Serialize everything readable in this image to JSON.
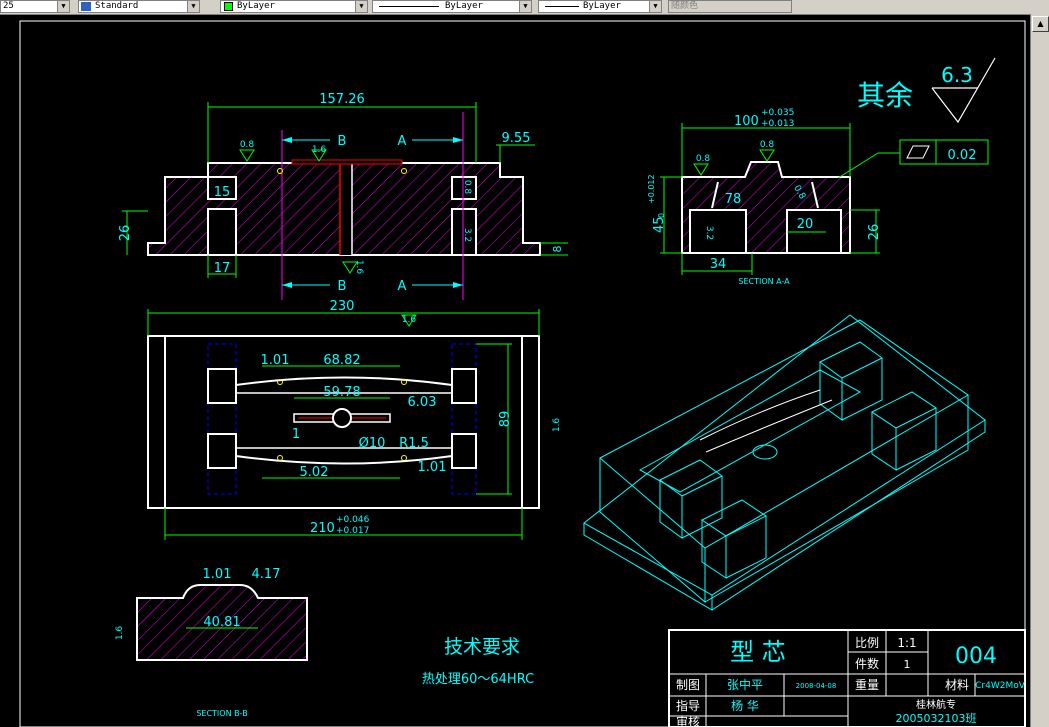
{
  "toolbar": {
    "field_left": "25",
    "text_style": "Standard",
    "layer_color": "ByLayer",
    "linetype": "ByLayer",
    "lineweight": "ByLayer",
    "plot_style": "随颜色"
  },
  "front_view": {
    "dim_overall": "157.26",
    "dim_right": "9.55",
    "dim_left_height": "26",
    "dim_step": "15",
    "dim_bottom_left": "17",
    "dim_right_small": "8",
    "rough_a": "0.8",
    "rough_b": "1.6",
    "rough_c": "0.8",
    "rough_d": "3.2",
    "rough_e": "1.6",
    "section_b_top": "B",
    "section_a_top": "A",
    "section_b_bottom": "B",
    "section_a_bottom": "A"
  },
  "section_aa": {
    "dim_width": "100",
    "tol_upper": "+0.035",
    "tol_lower": "+0.013",
    "dim_height": "45",
    "height_tol_upper": "+0.012",
    "height_tol_lower": "0",
    "dim_78": "78",
    "dim_20": "20",
    "dim_26": "26",
    "dim_34": "34",
    "rough_left": "0.8",
    "rough_mid": "0.8",
    "rough_right": "0.8",
    "rough_inner": "3.2",
    "flatness_value": "0.02",
    "label": "SECTION A-A"
  },
  "top_view": {
    "dim_overall": "230",
    "dim_inner": "210",
    "tol_upper": "+0.046",
    "tol_lower": "+0.017",
    "dim_height": "89",
    "dim_1_01_a": "1.01",
    "dim_68_82": "68.82",
    "dim_59_78": "59.78",
    "dim_6_03": "6.03",
    "dim_1": "1",
    "dim_phi10": "Ø10",
    "dim_r1_5": "R1.5",
    "dim_5_02": "5.02",
    "dim_1_01_b": "1.01",
    "rough_top": "1.6",
    "rough_right": "1.6"
  },
  "section_bb": {
    "dim_1_01": "1.01",
    "dim_4_17": "4.17",
    "dim_40_81": "40.81",
    "rough_left": "1.6",
    "label": "SECTION B-B"
  },
  "roughness_note": {
    "label": "其余",
    "value": "6.3"
  },
  "tech_req": {
    "title": "技术要求",
    "line1": "热处理60～64HRC"
  },
  "title_block": {
    "part_name": "型  芯",
    "scale_label": "比例",
    "scale_value": "1:1",
    "qty_label": "件数",
    "qty_value": "1",
    "drawing_no": "004",
    "drawn_label": "制图",
    "drawn_by": "张中平",
    "drawn_date": "2008-04-08",
    "weight_label": "重量",
    "material_label": "材料",
    "material_value": "Cr4W2MoV",
    "guide_label": "指导",
    "guide_by": "杨  华",
    "school": "桂林航专",
    "review_label": "审核",
    "class": "2005032103班"
  },
  "colors": {
    "white": "#ffffff",
    "cyan": "#00ffff",
    "green": "#00ff00",
    "magenta": "#ff00ff",
    "red": "#ff0000",
    "yellow": "#ffff00",
    "blue": "#0000ff"
  }
}
